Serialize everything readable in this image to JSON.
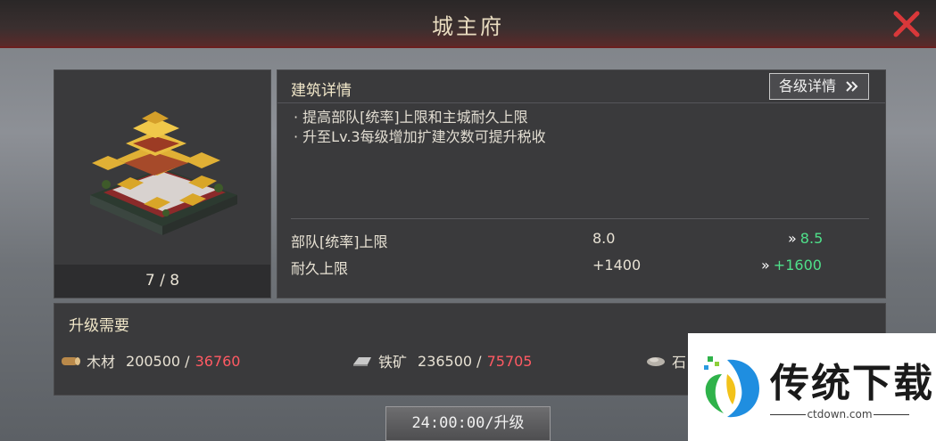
{
  "window": {
    "title": "城主府",
    "close_icon": "close-icon",
    "close_color": "#d9383a"
  },
  "building": {
    "level": "7 / 8"
  },
  "details": {
    "title": "建筑详情",
    "levels_button": "各级详情",
    "levels_button_icon": "double-chevron-right-icon",
    "description": [
      "· 提高部队[统率]上限和主城耐久上限",
      "· 升至Lv.3每级增加扩建次数可提升税收"
    ],
    "stats": [
      {
        "label": "部队[统率]上限",
        "current": "8.0",
        "next": "8.5"
      },
      {
        "label": "耐久上限",
        "current": "+1400",
        "next": "+1600"
      }
    ]
  },
  "requirements": {
    "title": "升级需要",
    "items": [
      {
        "icon": "wood-icon",
        "name": "木材",
        "have": "200500 /",
        "need": "36760"
      },
      {
        "icon": "iron-icon",
        "name": "铁矿",
        "have": "236500 /",
        "need": "75705"
      },
      {
        "icon": "stone-icon",
        "name": "石",
        "have": "",
        "need": ""
      }
    ]
  },
  "upgrade_button": "24:00:00/升级",
  "watermark": {
    "brand": "传统下载",
    "url": "ctdown.com"
  },
  "colors": {
    "accent_green": "#4fe08a",
    "need_red": "#ff5a63",
    "title_gold": "#f1e7c9"
  }
}
